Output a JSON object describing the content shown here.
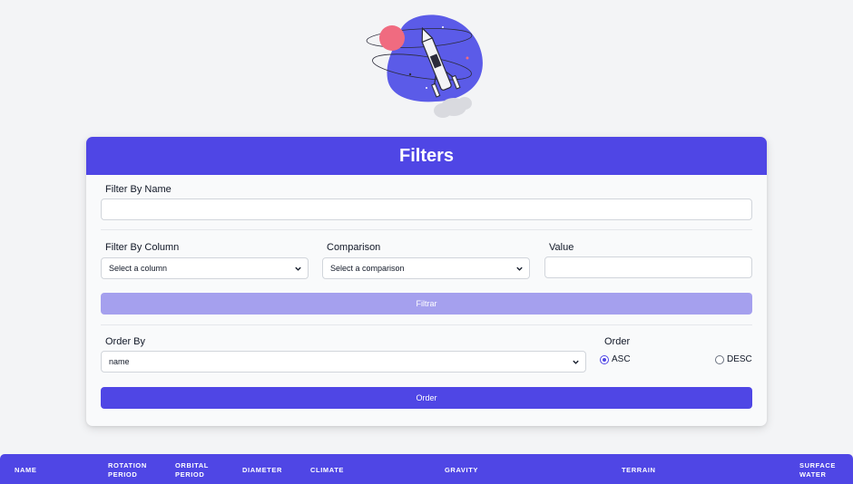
{
  "filters": {
    "title": "Filters",
    "filter_by_name_label": "Filter By Name",
    "name_value": "",
    "filter_by_column_label": "Filter By Column",
    "column_selected": "Select a column",
    "comparison_label": "Comparison",
    "comparison_selected": "Select a comparison",
    "value_label": "Value",
    "value_input": "",
    "filter_button": "Filtrar",
    "order_by_label": "Order By",
    "order_by_selected": "name",
    "order_label": "Order",
    "asc_label": "ASC",
    "desc_label": "DESC",
    "asc_checked": true,
    "order_button": "Order"
  },
  "table": {
    "columns": [
      "NAME",
      "ROTATION PERIOD",
      "ORBITAL PERIOD",
      "DIAMETER",
      "CLIMATE",
      "GRAVITY",
      "TERRAIN",
      "SURFACE WATER"
    ]
  },
  "colors": {
    "primary": "#4f46e5",
    "primary_disabled": "#a5a0ee",
    "background": "#f3f4f6"
  },
  "icons": {
    "hero": "rocket-planet-illustration",
    "select_arrow": "chevron-down-icon"
  }
}
